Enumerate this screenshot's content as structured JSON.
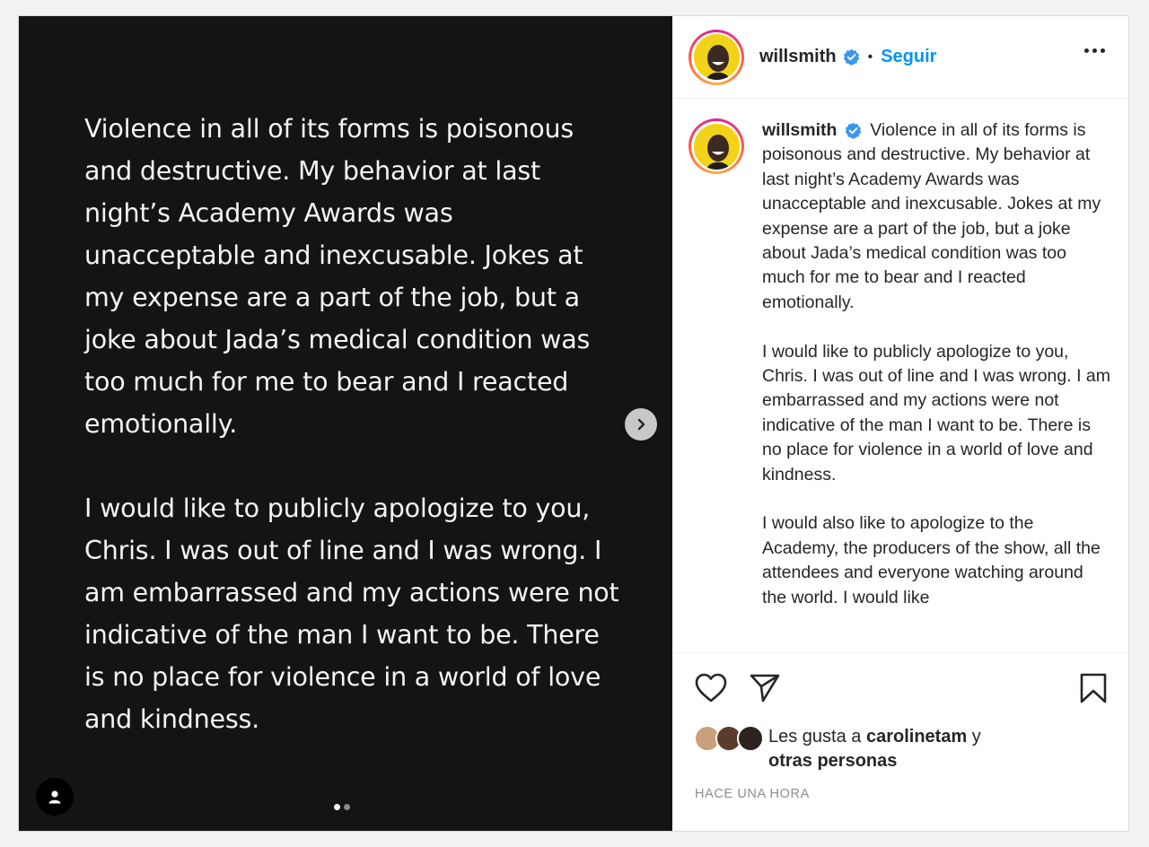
{
  "post": {
    "username": "willsmith",
    "follow_label": "Seguir",
    "separator": "•"
  },
  "slide": {
    "paragraph_1": "Violence in all of its forms is poisonous and destructive. My behavior at last night’s Academy Awards was unacceptable and inexcusable. Jokes at my expense are a part of the job, but a joke about Jada’s medical condition was too much for me to bear and I reacted emotionally.",
    "paragraph_2": "I would like to publicly apologize to you, Chris. I was out of line and I was wrong. I am embarrassed and my actions were not indicative of the man I want to be. There is no place for violence in a world of love and kindness.",
    "current_index": 1,
    "total": 2
  },
  "caption": {
    "username": "willsmith",
    "paragraph_1": "Violence in all of its forms is poisonous and destructive. My behavior at last night’s Academy Awards was unacceptable and inexcusable. Jokes at my expense are a part of the job, but a joke about Jada’s medical condition was too much for me to bear and I reacted emotionally.",
    "paragraph_2": "I would like to publicly apologize to you, Chris. I was out of line and I was wrong. I am embarrassed and my actions were not indicative of the man I want to be. There is no place for violence in a world of love and kindness.",
    "paragraph_3": "I would also like to apologize to the Academy, the producers of the show, all the attendees and everyone watching around the world. I would like"
  },
  "likes": {
    "prefix": "Les gusta a ",
    "user": "carolinetam",
    "connector": " y",
    "others": "otras personas"
  },
  "timestamp": "HACE UNA HORA",
  "icons": {
    "like": "heart-icon",
    "share": "send-icon",
    "save": "bookmark-icon",
    "next": "chevron-right-icon",
    "tags": "user-tag-icon",
    "more": "more-options-icon",
    "verified": "verified-badge-icon"
  },
  "colors": {
    "follow_blue": "#0095f6",
    "verified_blue": "#3897f0",
    "media_bg": "#141414",
    "avatar_yellow": "#f3d317"
  }
}
